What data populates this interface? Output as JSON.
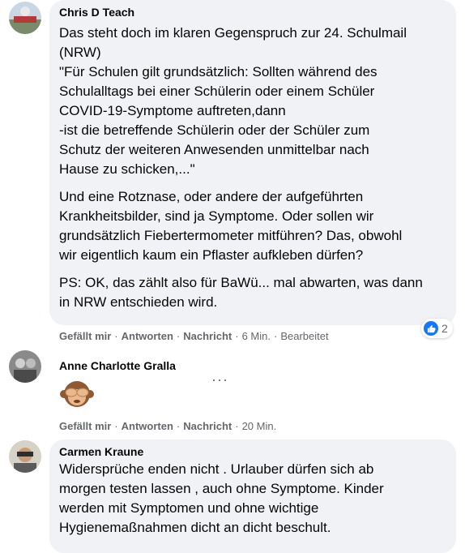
{
  "comments": [
    {
      "author": "Chris D Teach",
      "paragraphs": [
        "Das steht doch im klaren Gegenspruch zur 24. Schulmail\n(NRW)\n\"Für Schulen gilt grundsätzlich: Sollten während des\nSchulalltags bei einer Schülerin oder einem Schüler\nCOVID-19-Symptome auftreten,dann\n-ist die betreffende Schülerin oder der Schüler zum\nSchutz der weiteren Anwesenden unmittelbar nach\nHause zu schicken,...\"",
        "Und eine Rotznase, oder andere der aufgeführten\nKrankheitsbilder, sind ja Symptome. Oder sollen wir\ngrundsätzlich Fiebertermometer mitführen? Das, obwohl\nwir eigentlich kaum ein Pflaster aufkleben dürfen?",
        "PS: OK, das zählt also für BaWü... mal abwarten, was dann\nin NRW entschieden wird."
      ],
      "like_label": "Gefällt mir",
      "reply_label": "Antworten",
      "message_label": "Nachricht",
      "time": "6 Min.",
      "edited": "Bearbeitet",
      "reaction_count": "2",
      "reaction_icon": "thumbs-up-icon"
    },
    {
      "author": "Anne Charlotte Gralla",
      "sticker_icon": "see-no-evil-monkey-icon",
      "like_label": "Gefällt mir",
      "reply_label": "Antworten",
      "message_label": "Nachricht",
      "time": "20 Min.",
      "more_icon": "more-options-icon"
    },
    {
      "author": "Carmen Kraune",
      "paragraphs": [
        "Widersprüche enden nicht . Urlauber dürfen sich ab\nmorgen testen lassen , auch ohne Symptome. Kinder\nwerden mit Symptomen und ohne wichtige\nHygienemaßnahmen dicht an dicht beschult."
      ]
    }
  ],
  "colors": {
    "bubble": "#f0f2f5",
    "meta": "#65676b",
    "accent": "#1877f2",
    "text": "#050505"
  }
}
